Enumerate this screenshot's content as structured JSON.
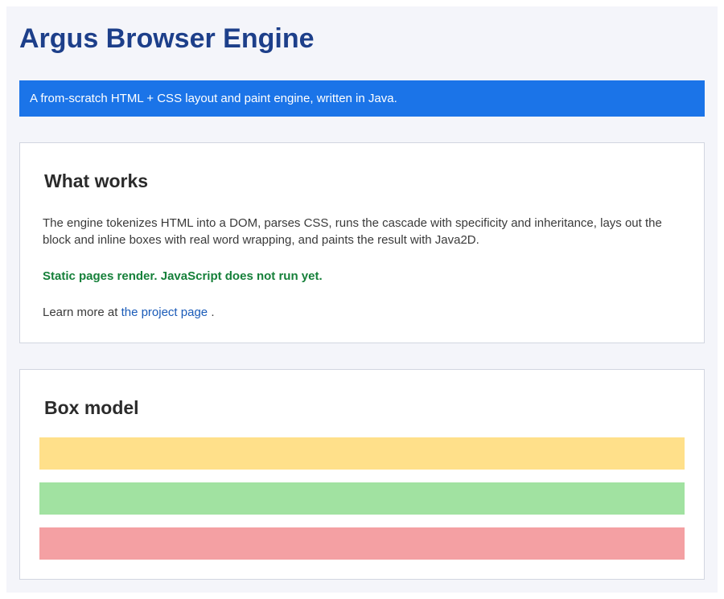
{
  "header": {
    "title": "Argus Browser Engine",
    "tagline": "A from-scratch HTML + CSS layout and paint engine, written in Java."
  },
  "what_works": {
    "heading": "What works",
    "description": "The engine tokenizes HTML into a DOM, parses CSS, runs the cascade with specificity and inheritance, lays out the block and inline boxes with real word wrapping, and paints the result with Java2D.",
    "status": "Static pages render. JavaScript does not run yet.",
    "learn_prefix": "Learn more at",
    "link_text": "the project page",
    "learn_suffix": "."
  },
  "box_model": {
    "heading": "Box model",
    "bars": [
      {
        "color": "#ffe08a"
      },
      {
        "color": "#a1e2a1"
      },
      {
        "color": "#f4a0a3"
      }
    ]
  },
  "colors": {
    "title": "#1d3f8a",
    "tagline_bg": "#1b74e8",
    "status": "#16803a",
    "link": "#1a5bb8",
    "page_bg": "#f4f5fa"
  }
}
